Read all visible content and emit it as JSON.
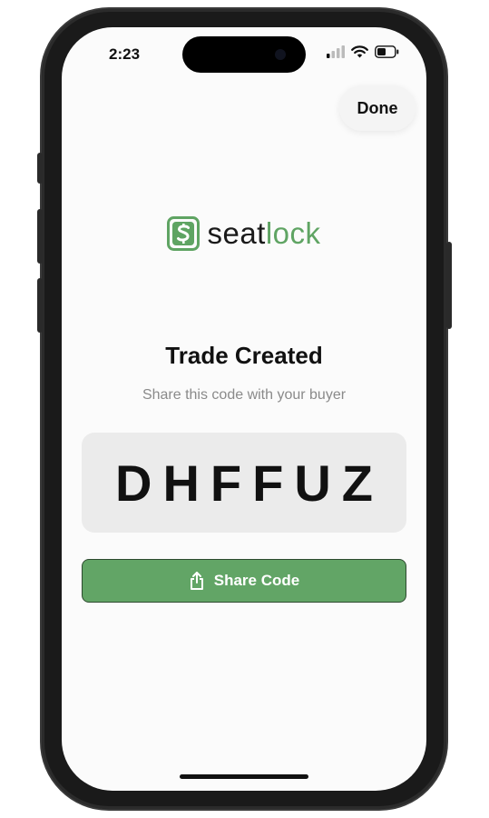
{
  "status_bar": {
    "time": "2:23"
  },
  "header": {
    "done_label": "Done"
  },
  "logo": {
    "word_part1": "seat",
    "word_part2": "lock",
    "brand_color": "#5fa463"
  },
  "main": {
    "title": "Trade Created",
    "subtitle": "Share this code with your buyer",
    "code": "DHFFUZ",
    "share_label": "Share Code"
  },
  "icons": {
    "signal": "cellular-signal-icon",
    "wifi": "wifi-icon",
    "battery": "battery-icon",
    "share": "share-icon",
    "logo": "seatlock-logo-icon"
  }
}
